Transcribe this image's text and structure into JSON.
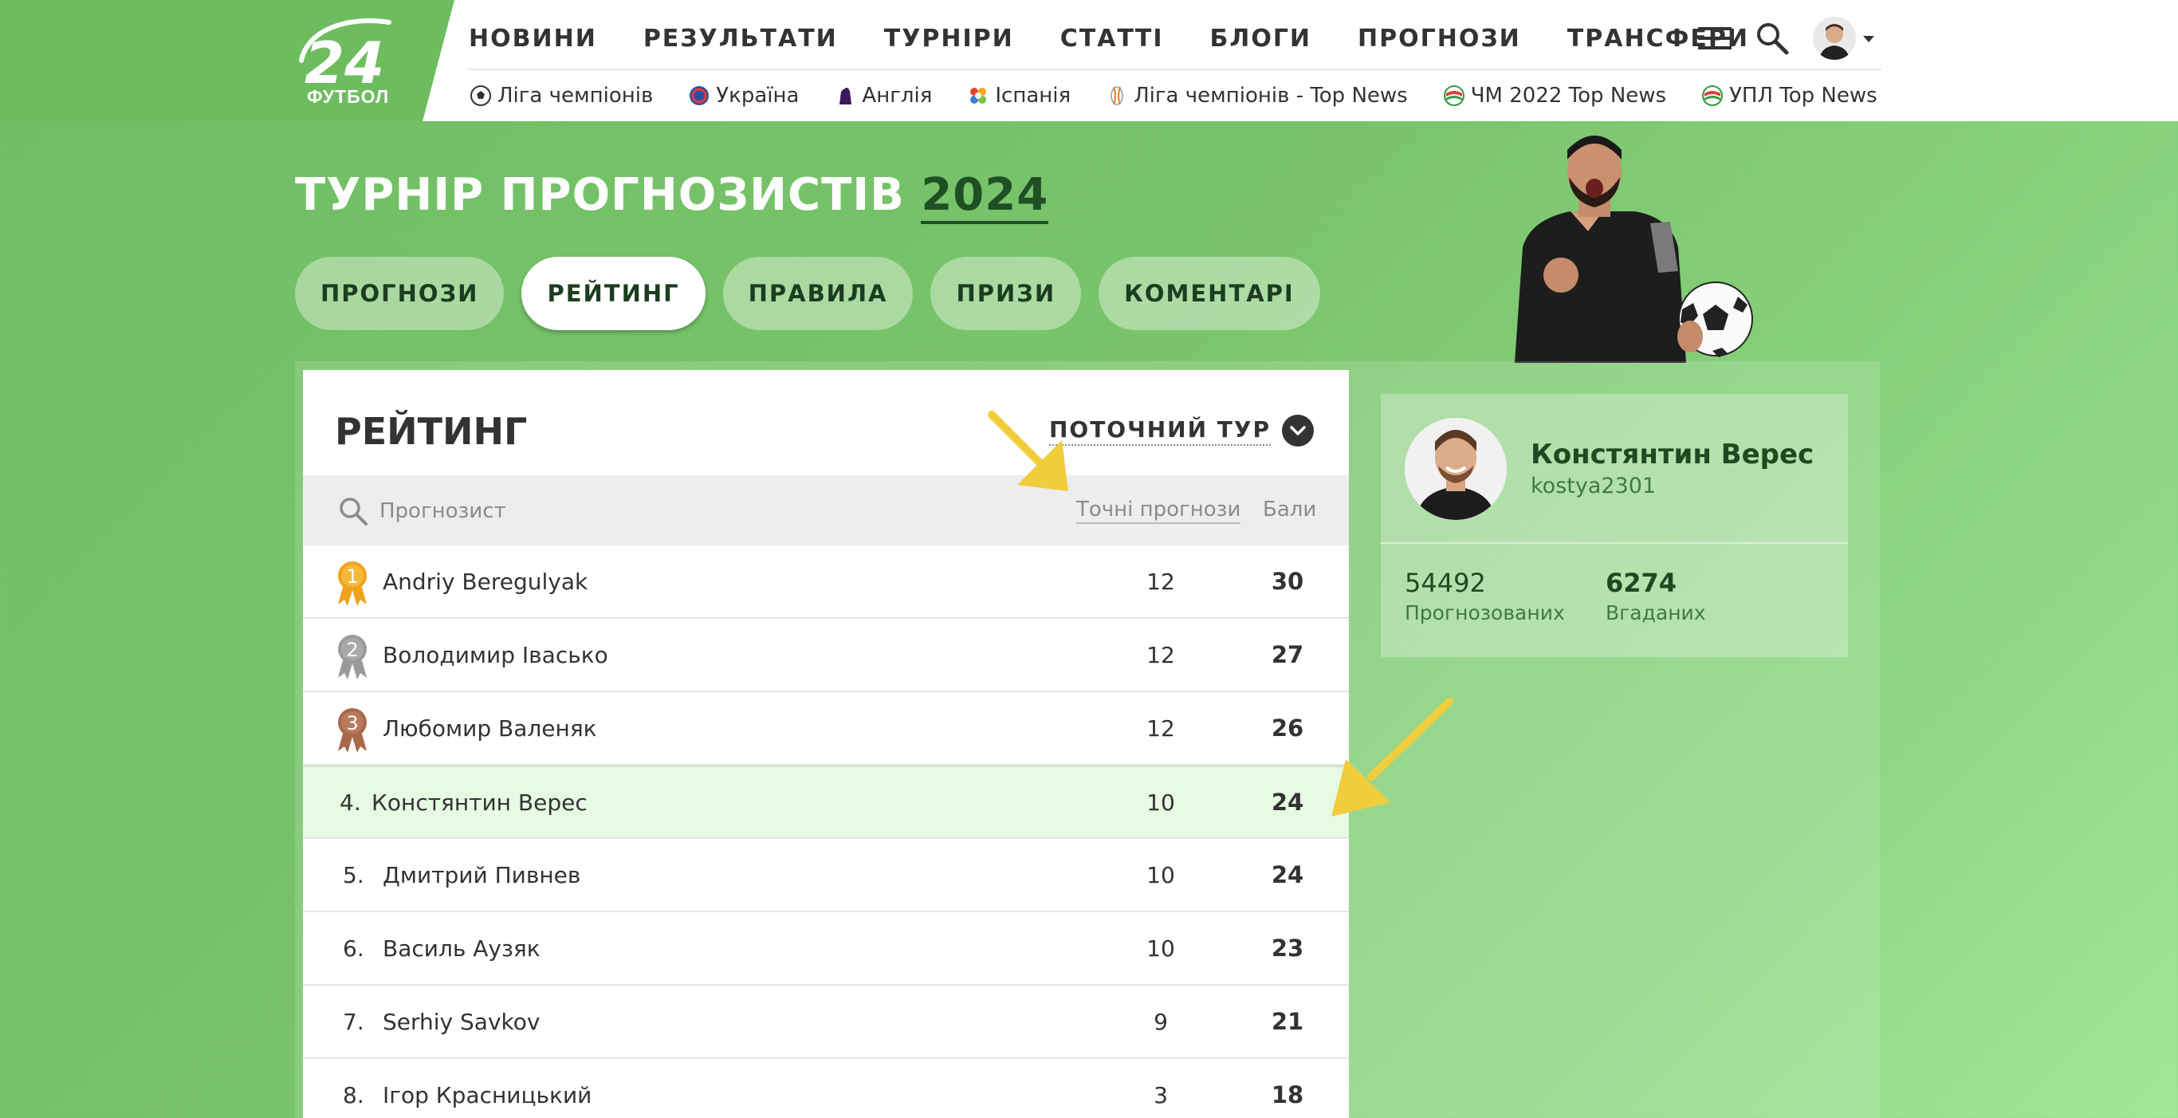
{
  "brand": {
    "logo_number": "24",
    "logo_subtitle": "ФУТБОЛ"
  },
  "nav": {
    "main": [
      "НОВИНИ",
      "РЕЗУЛЬТАТИ",
      "ТУРНІРИ",
      "СТАТТІ",
      "БЛОГИ",
      "ПРОГНОЗИ",
      "ТРАНСФЕРИ"
    ],
    "icons": [
      "menu-icon",
      "search-icon",
      "user-avatar",
      "chevron-down-icon"
    ],
    "sub": [
      {
        "label": "Ліга чемпіонів",
        "icon": "soccer-ball-icon"
      },
      {
        "label": "Україна",
        "icon": "ukraine-league-icon"
      },
      {
        "label": "Англія",
        "icon": "premier-league-icon"
      },
      {
        "label": "Іспанія",
        "icon": "laliga-icon"
      },
      {
        "label": "Ліга чемпіонів - Top News",
        "icon": "europa-trophy-icon"
      },
      {
        "label": "ЧМ 2022 Top News",
        "icon": "wc-badge-icon"
      },
      {
        "label": "УПЛ Top News",
        "icon": "upl-badge-icon"
      }
    ]
  },
  "page": {
    "title_main": "ТУРНІР ПРОГНОЗИСТІВ",
    "title_year": "2024",
    "tabs": [
      {
        "label": "ПРОГНОЗИ",
        "active": false
      },
      {
        "label": "РЕЙТИНГ",
        "active": true
      },
      {
        "label": "ПРАВИЛА",
        "active": false
      },
      {
        "label": "ПРИЗИ",
        "active": false
      },
      {
        "label": "КОМЕНТАРІ",
        "active": false
      }
    ]
  },
  "rating": {
    "title": "РЕЙТИНГ",
    "round_select": "ПОТОЧНИЙ ТУР",
    "search_placeholder": "Прогнозист",
    "col_exact": "Точні прогнози",
    "col_points": "Бали",
    "rows": [
      {
        "rank": "1",
        "name": "Andriy Beregulyak",
        "exact": "12",
        "points": "30",
        "medal": "gold"
      },
      {
        "rank": "2",
        "name": "Володимир Івасько",
        "exact": "12",
        "points": "27",
        "medal": "silver"
      },
      {
        "rank": "3",
        "name": "Любомир Валеняк",
        "exact": "12",
        "points": "26",
        "medal": "bronze"
      },
      {
        "rank": "4.",
        "name": "Констянтин Верес",
        "exact": "10",
        "points": "24",
        "medal": "",
        "current_user": true
      },
      {
        "rank": "5.",
        "name": "Дмитрий Пивнев",
        "exact": "10",
        "points": "24",
        "medal": ""
      },
      {
        "rank": "6.",
        "name": "Василь Аузяк",
        "exact": "10",
        "points": "23",
        "medal": ""
      },
      {
        "rank": "7.",
        "name": "Serhiy Savkov",
        "exact": "9",
        "points": "21",
        "medal": ""
      },
      {
        "rank": "8.",
        "name": "Ігор Красницький",
        "exact": "3",
        "points": "18",
        "medal": ""
      }
    ]
  },
  "profile": {
    "name": "Констянтин Верес",
    "username": "kostya2301",
    "predicted_value": "54492",
    "predicted_label": "Прогнозованих",
    "guessed_value": "6274",
    "guessed_label": "Вгаданих"
  },
  "colors": {
    "page_green": "#79c46b",
    "dark_green": "#1c4a21",
    "highlight_row": "#e6fbe2",
    "gold": "#f0a21b",
    "silver": "#9a9a9a",
    "bronze": "#a8684a",
    "arrow_yellow": "#f2cd3b"
  }
}
